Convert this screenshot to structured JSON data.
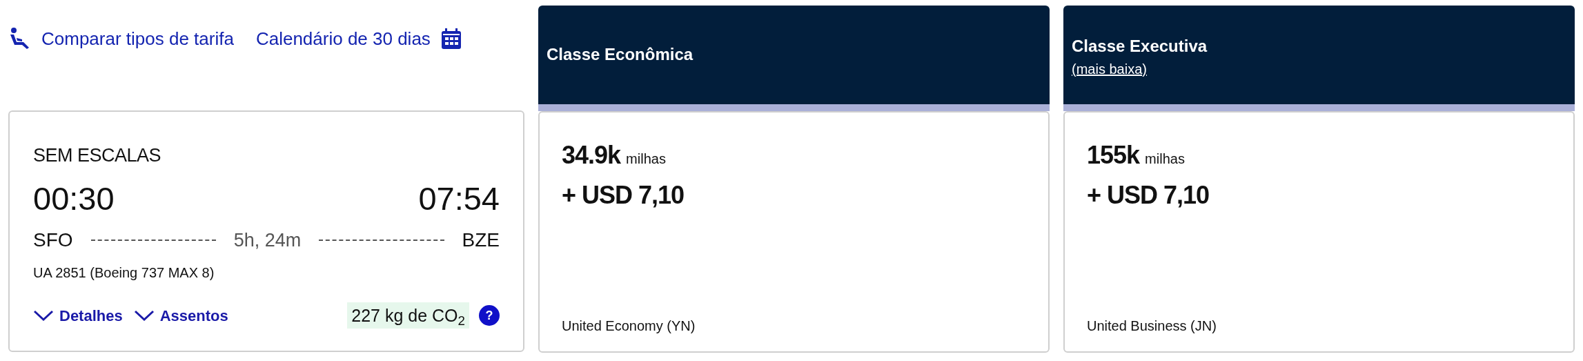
{
  "links": [
    {
      "label": "Comparar tipos de tarifa",
      "kind": "seat"
    },
    {
      "label": "Calendário de 30 dias",
      "kind": "calendar"
    }
  ],
  "flight": {
    "stops": "SEM ESCALAS",
    "depart_time": "00:30",
    "arrive_time": "07:54",
    "origin": "SFO",
    "duration": "5h, 24m",
    "destination": "BZE",
    "flight_info": "UA 2851 (Boeing 737 MAX 8)",
    "toggles": [
      {
        "label": "Detalhes",
        "expanded": false
      },
      {
        "label": "Assentos",
        "expanded": false
      }
    ],
    "emissions": "227 kg de CO$_{2}$",
    "help": "?"
  },
  "fares": [
    {
      "title": "Classe Econômica",
      "miles": "34.9k",
      "miles_unit": "milhas",
      "price": "+ USD 7,10",
      "fare_name": "United Economy (YN)"
    },
    {
      "title": "Classe Executiva",
      "subtitle": "(mais baixa)",
      "miles": "155k",
      "miles_unit": "milhas",
      "price": "+ USD 7,10",
      "fare_name": "United Business (JN)"
    }
  ]
}
